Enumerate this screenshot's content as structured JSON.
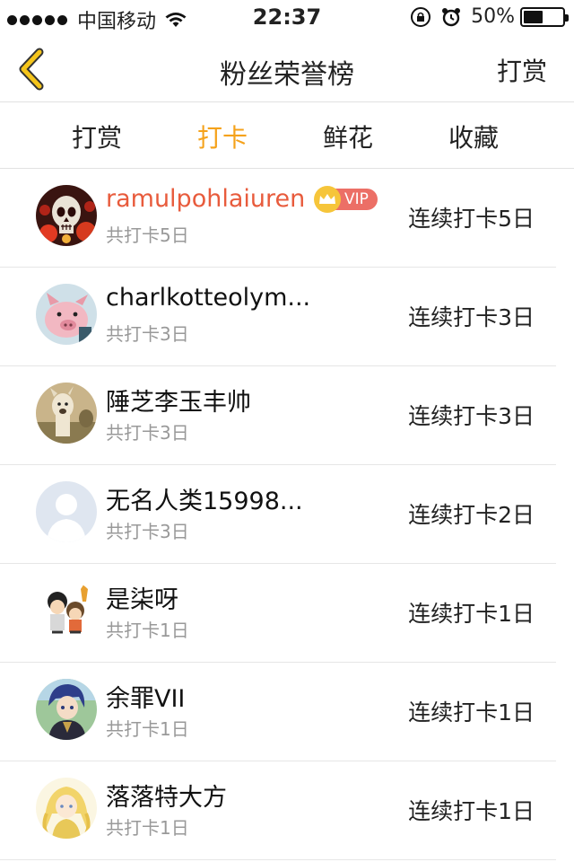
{
  "status_bar": {
    "carrier": "中国移动",
    "time": "22:37",
    "battery_text": "50%",
    "battery_level": 0.5
  },
  "nav": {
    "title": "粉丝荣誉榜",
    "action_label": "打赏"
  },
  "tabs": [
    {
      "label": "打赏",
      "active": false
    },
    {
      "label": "打卡",
      "active": true
    },
    {
      "label": "鲜花",
      "active": false
    },
    {
      "label": "收藏",
      "active": false
    }
  ],
  "colors": {
    "accent": "#f5a21b",
    "vip_name": "#e85b3c",
    "vip_badge": "#ec6f66",
    "back_arrow": "#f5c51b"
  },
  "fans": [
    {
      "name": "ramulpohlaiuren",
      "vip": true,
      "vip_label": "VIP",
      "total": "共打卡5日",
      "streak": "连续打卡5日",
      "avatar": "skull-avatar"
    },
    {
      "name": "charlkotteolym...",
      "vip": false,
      "total": "共打卡3日",
      "streak": "连续打卡3日",
      "avatar": "pig-avatar"
    },
    {
      "name": "陲芝李玉丰帅",
      "vip": false,
      "total": "共打卡3日",
      "streak": "连续打卡3日",
      "avatar": "alpaca-avatar"
    },
    {
      "name": "无名人类15998...",
      "vip": false,
      "total": "共打卡3日",
      "streak": "连续打卡2日",
      "avatar": "default-avatar"
    },
    {
      "name": "是柒呀",
      "vip": false,
      "total": "共打卡1日",
      "streak": "连续打卡1日",
      "avatar": "cartoon-avatar"
    },
    {
      "name": "余罪VII",
      "vip": false,
      "total": "共打卡1日",
      "streak": "连续打卡1日",
      "avatar": "anime-avatar"
    },
    {
      "name": "落落特大方",
      "vip": false,
      "total": "共打卡1日",
      "streak": "连续打卡1日",
      "avatar": "blonde-avatar"
    }
  ]
}
